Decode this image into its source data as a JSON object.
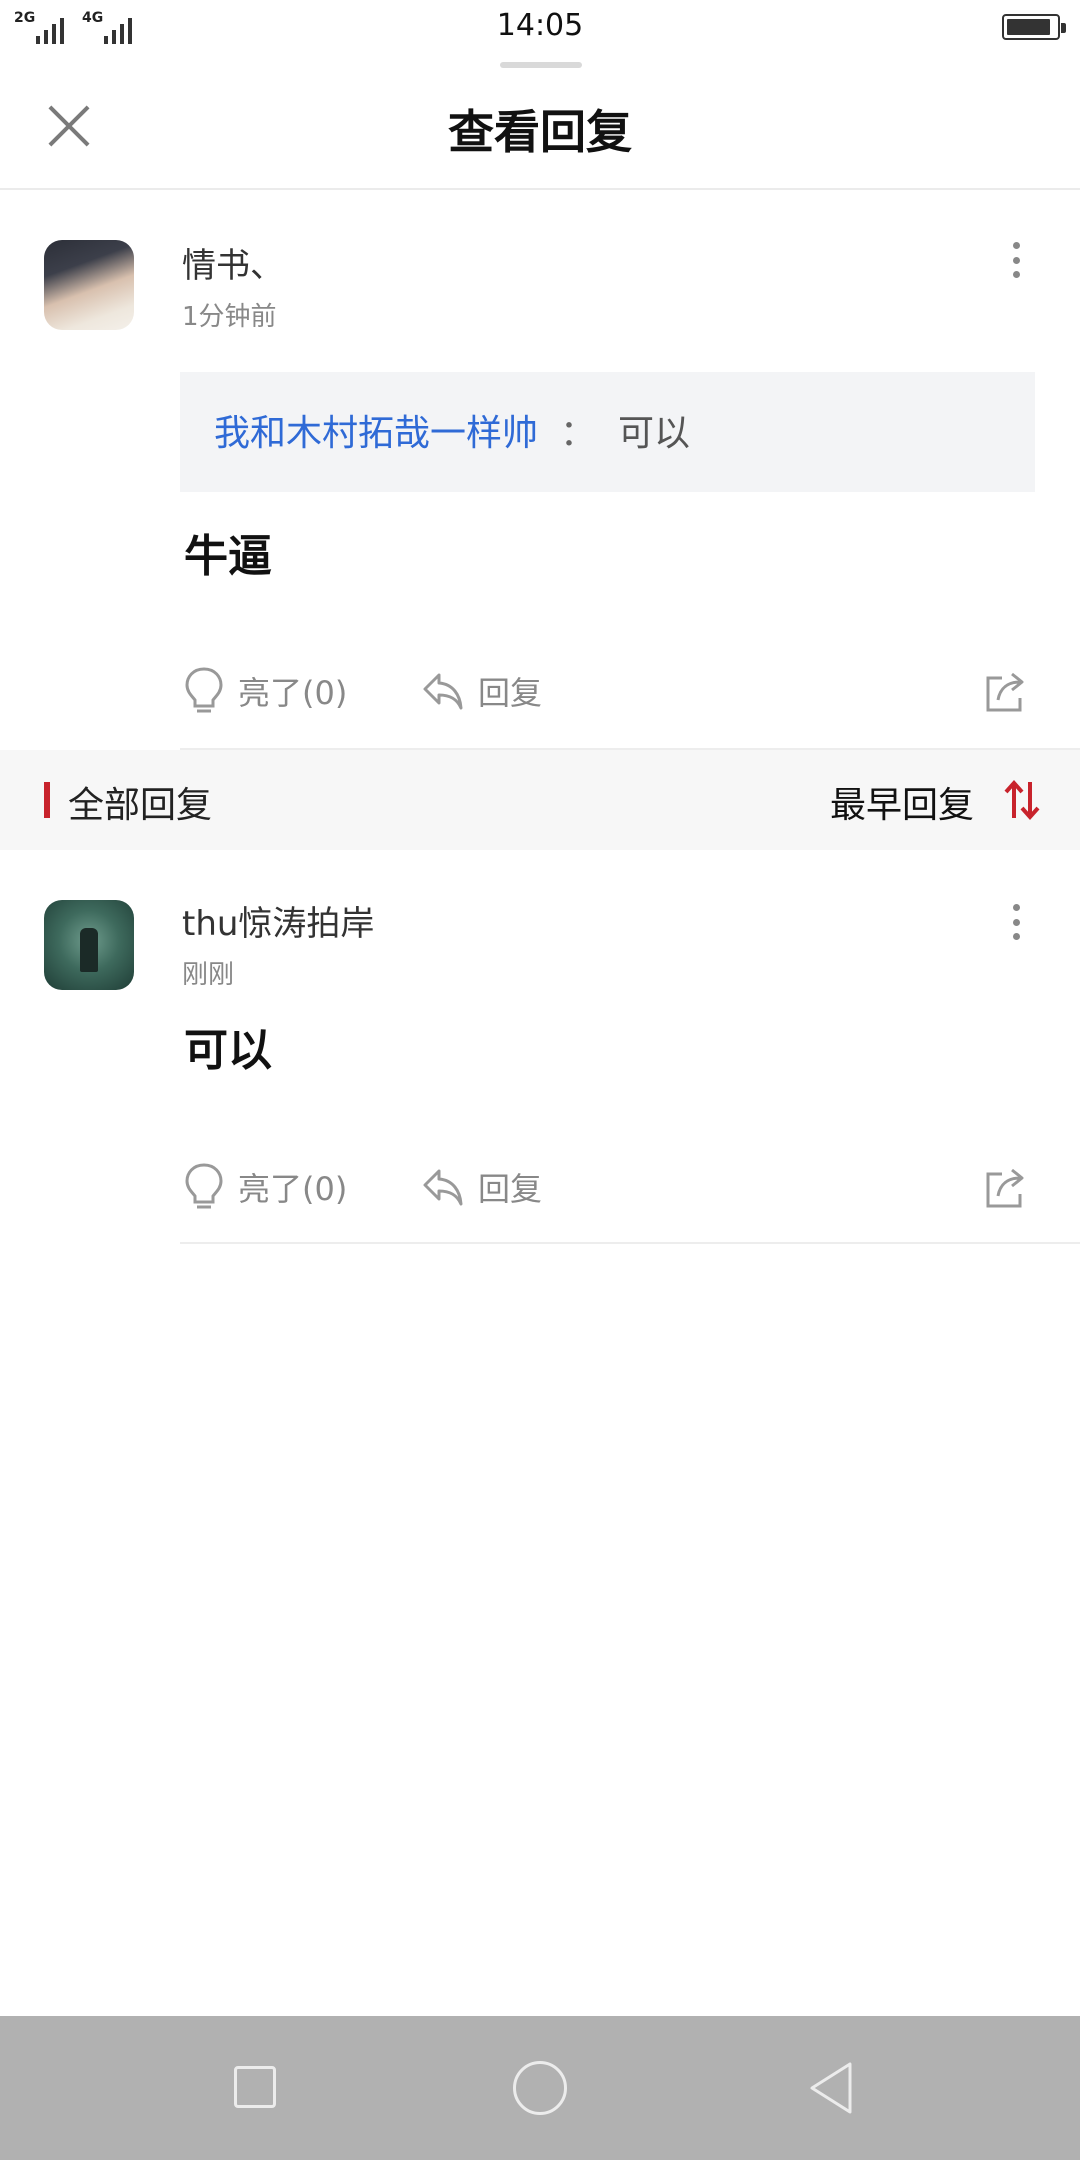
{
  "status_bar": {
    "network_1": "2G",
    "network_2": "4G",
    "time": "14:05",
    "battery_level": 0.9
  },
  "header": {
    "title": "查看回复"
  },
  "post": {
    "username": "情书、",
    "timestamp": "1分钟前",
    "quote": {
      "user": "我和木村拓哉一样帅",
      "separator": "：",
      "text": "可以"
    },
    "content": "牛逼",
    "like_label": "亮了(0)",
    "reply_label": "回复"
  },
  "section": {
    "title": "全部回复",
    "sort_label": "最早回复",
    "accent_color": "#c8232c"
  },
  "replies": [
    {
      "username": "thu惊涛拍岸",
      "timestamp": "刚刚",
      "content": "可以",
      "like_label": "亮了(0)",
      "reply_label": "回复"
    }
  ],
  "icons": {
    "close": "close-icon",
    "more": "more-vertical-icon",
    "like": "lightbulb-icon",
    "reply": "reply-arrow-icon",
    "share": "share-icon",
    "sort": "sort-arrows-icon"
  }
}
